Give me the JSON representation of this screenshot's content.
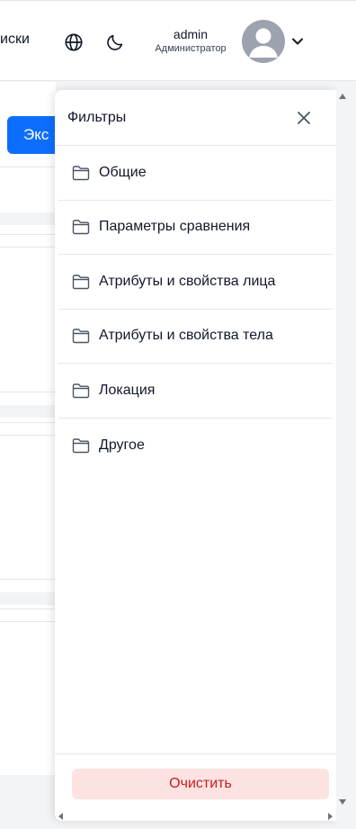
{
  "header": {
    "nav_partial": "иски",
    "user_name": "admin",
    "user_role": "Администратор"
  },
  "content": {
    "export_label": "Экс"
  },
  "filters": {
    "title": "Фильтры",
    "items": [
      {
        "label": "Общие"
      },
      {
        "label": "Параметры сравнения"
      },
      {
        "label": "Атрибуты и свойства лица"
      },
      {
        "label": "Атрибуты и свойства тела"
      },
      {
        "label": "Локация"
      },
      {
        "label": "Другое"
      }
    ],
    "clear_label": "Очистить"
  },
  "colors": {
    "accent": "#0d6efd",
    "danger_text": "#c81e1e",
    "danger_bg": "#fde2e2"
  },
  "icons": [
    "globe-icon",
    "moon-icon",
    "avatar-icon",
    "chevron-down-icon",
    "close-icon",
    "folder-icon"
  ]
}
